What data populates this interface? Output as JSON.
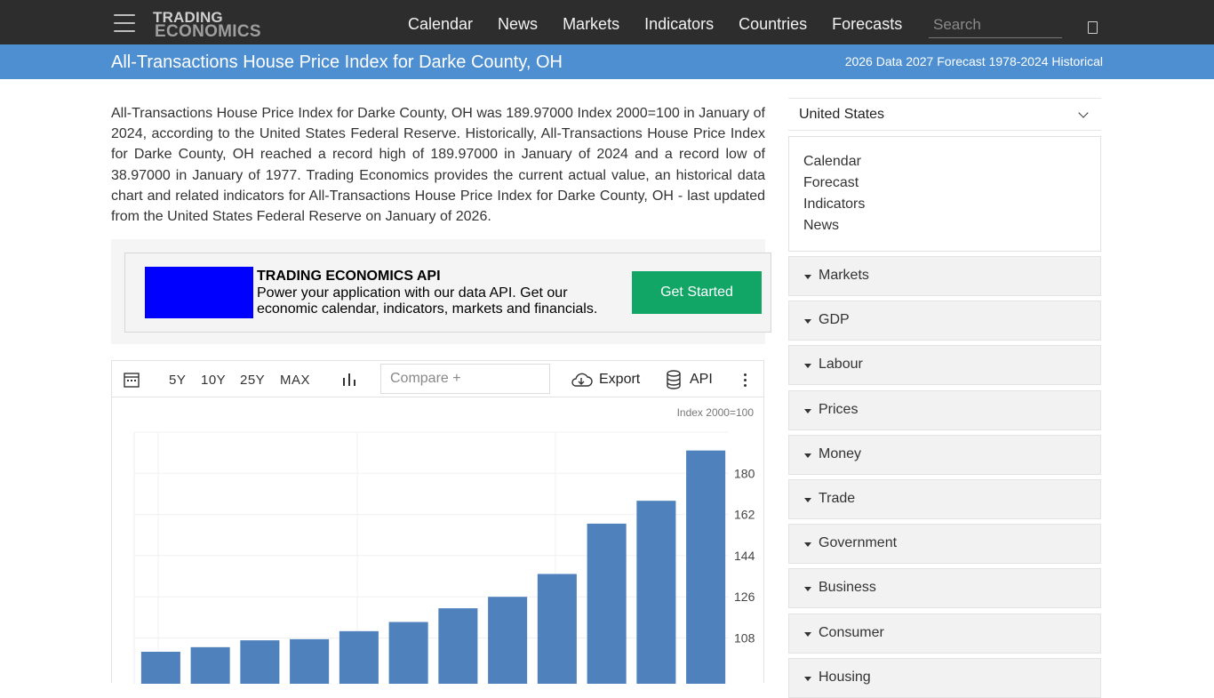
{
  "nav": {
    "logo_line1": "TRADING",
    "logo_line2": "ECONOMICS",
    "links": [
      "Calendar",
      "News",
      "Markets",
      "Indicators",
      "Countries",
      "Forecasts"
    ],
    "search_placeholder": "Search"
  },
  "title_bar": {
    "title": "All-Transactions House Price Index for Darke County, OH",
    "meta": "2026 Data 2027 Forecast 1978-2024 Historical"
  },
  "description": "All-Transactions House Price Index for Darke County, OH was 189.97000 Index 2000=100 in January of 2024, according to the United States Federal Reserve. Historically, All-Transactions House Price Index for Darke County, OH reached a record high of 189.97000 in January of 2024 and a record low of 38.97000 in January of 1977. Trading Economics provides the current actual value, an historical data chart and related indicators for All-Transactions House Price Index for Darke County, OH - last updated from the United States Federal Reserve on January of 2026.",
  "promo": {
    "title": "TRADING ECONOMICS API",
    "text": "Power your application with our data API. Get our economic calendar, indicators, markets and financials.",
    "button": "Get Started",
    "image_color": "#0000ff",
    "button_color": "#11a566"
  },
  "toolbar": {
    "ranges": [
      "5Y",
      "10Y",
      "25Y",
      "MAX"
    ],
    "compare_placeholder": "Compare +",
    "export_label": "Export",
    "api_label": "API"
  },
  "chart_data": {
    "type": "bar",
    "unit_label": "Index 2000=100",
    "y_ticks": [
      108,
      126,
      144,
      162,
      180
    ],
    "values": [
      102,
      104,
      107,
      107.5,
      111,
      115,
      121,
      126,
      136,
      158,
      168,
      189.97
    ],
    "ylim": [
      88,
      198
    ],
    "grid": true,
    "bar_color": "#4f81bd"
  },
  "sidebar": {
    "country": "United States",
    "quick_links": [
      "Calendar",
      "Forecast",
      "Indicators",
      "News"
    ],
    "categories": [
      "Markets",
      "GDP",
      "Labour",
      "Prices",
      "Money",
      "Trade",
      "Government",
      "Business",
      "Consumer",
      "Housing"
    ]
  },
  "colors": {
    "navbar": "#2d2d2d",
    "title_bar": "#4d8fd1"
  }
}
